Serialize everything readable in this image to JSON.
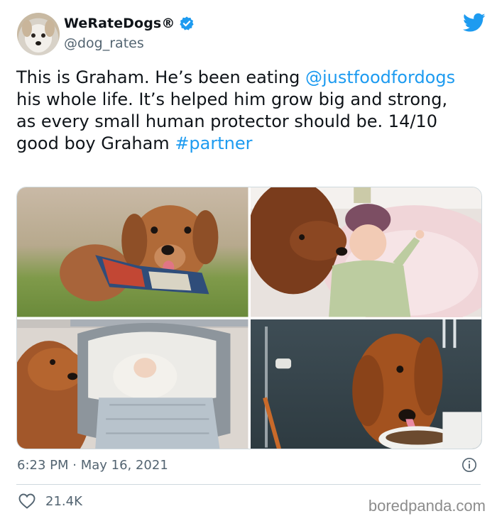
{
  "tweet": {
    "display_name": "WeRateDogs®",
    "handle": "@dog_rates",
    "text_part1": "This is Graham. He’s been eating ",
    "mention": "@justfoodfordogs",
    "text_part2": " his whole life. It’s helped him grow big and strong, as every small human protector should be. 14/10 good boy Graham ",
    "hashtag": "#partner",
    "timestamp": "6:23 PM · May 16, 2021",
    "likes": "21.4K"
  },
  "watermark": "boredpanda.com",
  "colors": {
    "link": "#1d9bf0",
    "secondary_text": "#536471",
    "divider": "#cfd9de"
  },
  "icons": {
    "verified": "verified-badge-icon",
    "twitter": "twitter-bird-icon",
    "info": "info-icon",
    "like": "heart-icon"
  }
}
